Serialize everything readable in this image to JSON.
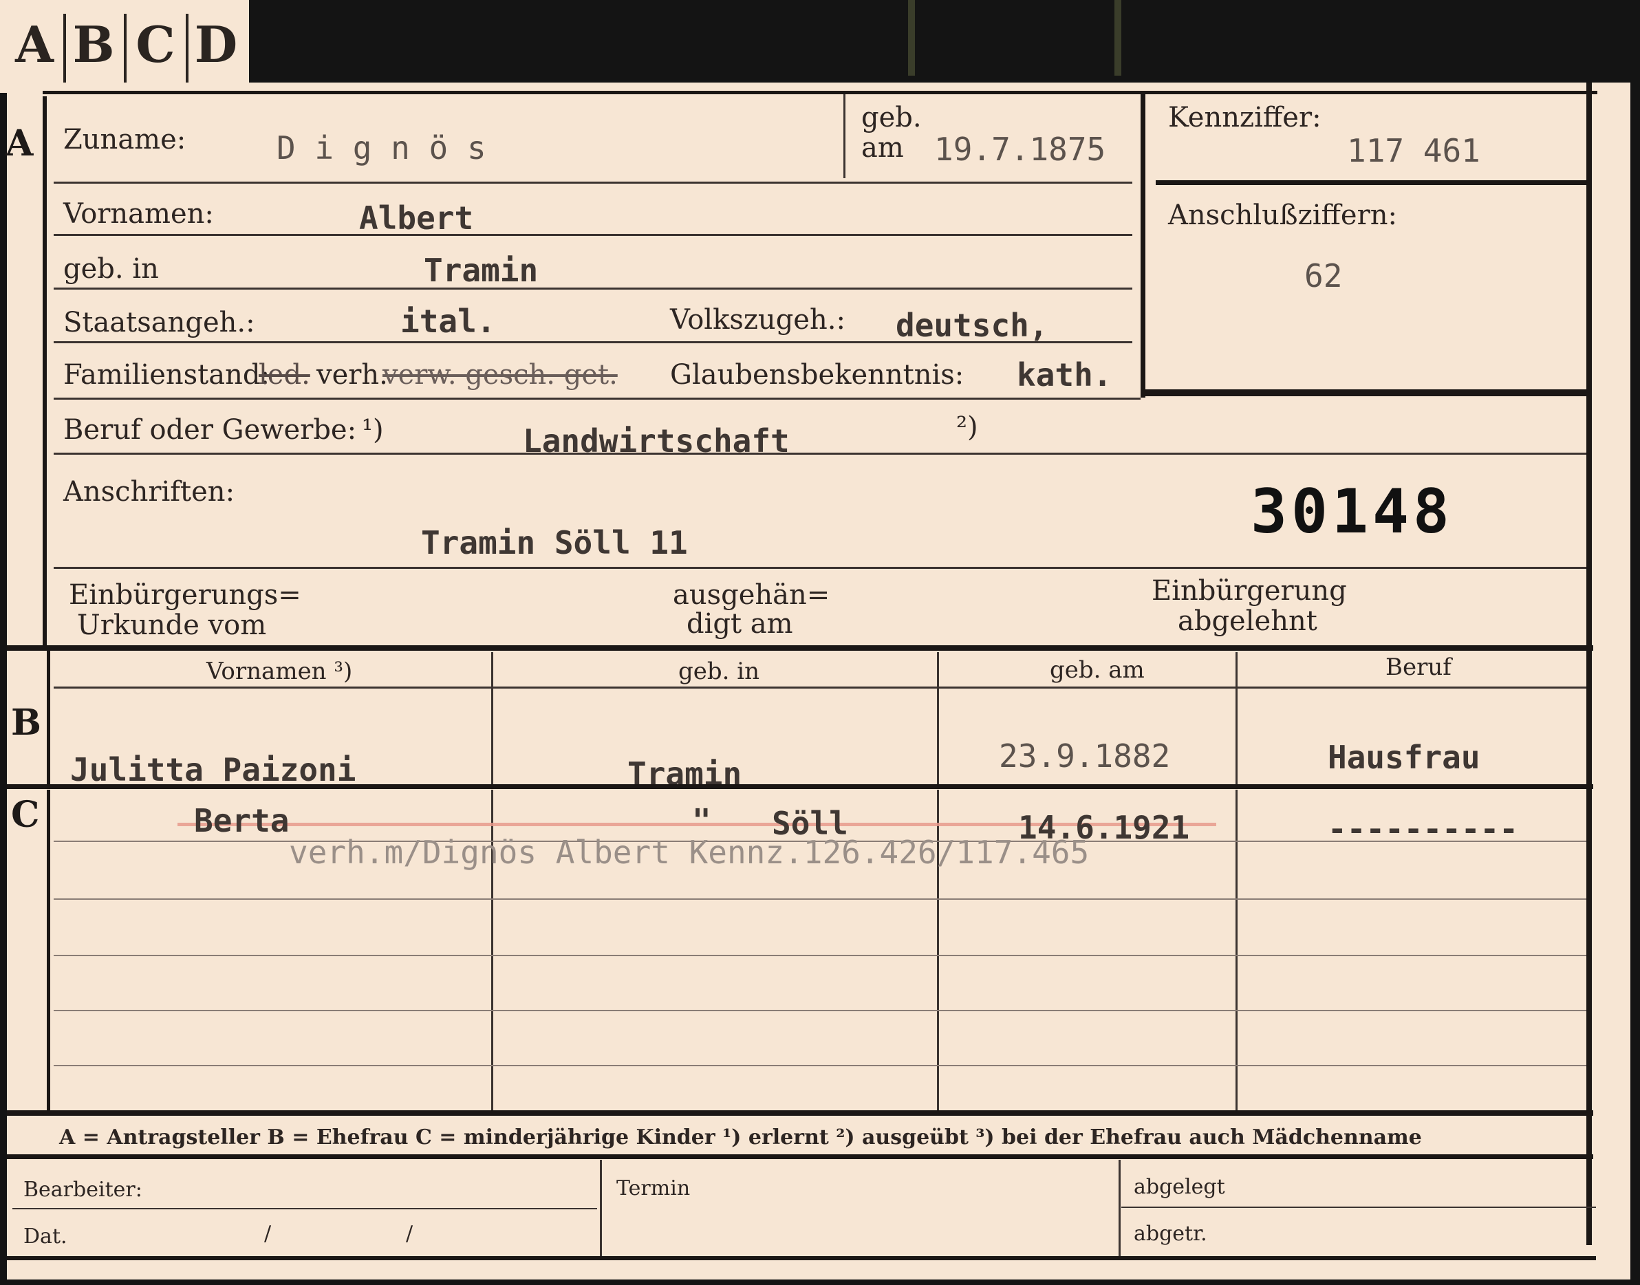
{
  "tabs": [
    "A",
    "B",
    "C",
    "D"
  ],
  "sectionA": {
    "marker": "A",
    "zuname_label": "Zuname:",
    "zuname_value": "D i g n ö s",
    "geb_label_top": "geb.",
    "geb_label_bottom": "am",
    "geb_value": "19.7.1875",
    "kennziffer_label": "Kennziffer:",
    "kennziffer_value": "117 461",
    "vornamen_label": "Vornamen:",
    "vornamen_value": "Albert",
    "gebin_label": "geb. in",
    "gebin_value": "Tramin",
    "anschluss_label": "Anschlußziffern:",
    "anschluss_value": "62",
    "staats_label": "Staatsangeh.:",
    "staats_value": "ital.",
    "volks_label": "Volkszugeh.:",
    "volks_value": "deutsch,",
    "familien_label": "Familienstand:",
    "familien_crossed_1": "led.",
    "familien_selected": "verh.",
    "familien_crossed_2": "verw. gesch. get.",
    "glaube_label": "Glaubensbekenntnis:",
    "glaube_value": "kath.",
    "beruf_label": "Beruf oder Gewerbe:",
    "beruf_fn1": "¹)",
    "beruf_value": "Landwirtschaft",
    "beruf_fn2": "²)",
    "anschriften_label": "Anschriften:",
    "anschriften_value": "Tramin Söll 11",
    "stamp_number": "30148",
    "einb_urkunde_1": "Einbürgerungs=",
    "einb_urkunde_2": "Urkunde vom",
    "ausgehaen_1": "ausgehän=",
    "ausgehaen_2": "digt am",
    "einb_abgelehnt_1": "Einbürgerung",
    "einb_abgelehnt_2": "abgelehnt"
  },
  "sectionB": {
    "marker": "B",
    "headers": [
      "Vornamen ³)",
      "geb. in",
      "geb. am",
      "Beruf"
    ],
    "row": {
      "vornamen": "Julitta  Paizoni",
      "geb_in": "Tramin",
      "geb_am": "23.9.1882",
      "beruf": "Hausfrau"
    }
  },
  "sectionC": {
    "marker": "C",
    "row": {
      "vornamen": "Berta",
      "geb_in_ditto": "\"",
      "geb_in": "Söll",
      "geb_am": "14.6.1921",
      "beruf": "----------"
    },
    "note": "verh.m/Dignös Albert Kennz.126.426/117.465"
  },
  "legend": "A = Antragsteller   B = Ehefrau   C = minderjährige Kinder   ¹) erlernt   ²) ausgeübt   ³) bei der Ehefrau auch Mädchenname",
  "footer": {
    "bearbeiter": "Bearbeiter:",
    "dat": "Dat.",
    "slash1": "/",
    "slash2": "/",
    "termin": "Termin",
    "abgelegt": "abgelegt",
    "abgetr": "abgetr."
  }
}
